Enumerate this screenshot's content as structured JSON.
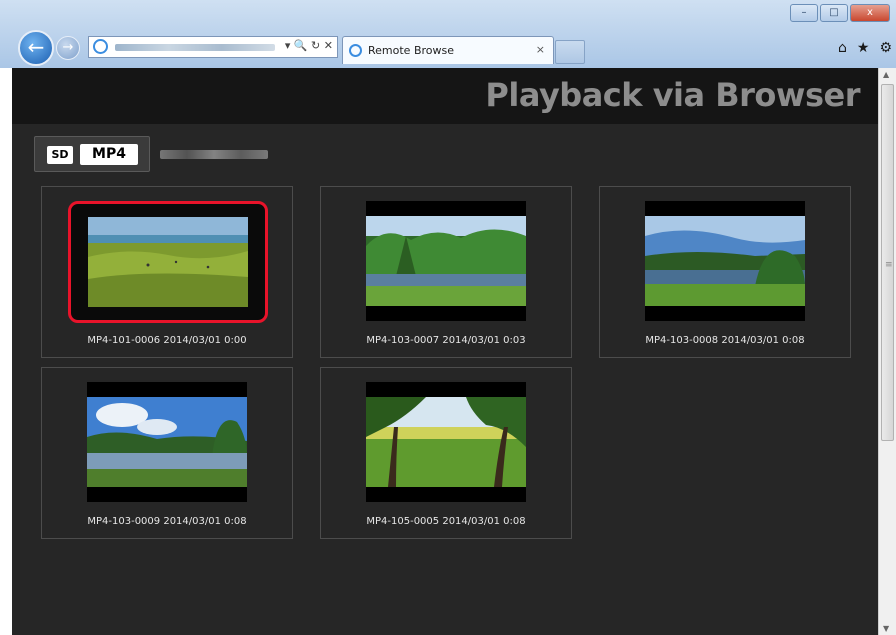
{
  "window": {
    "minimize_glyph": "–",
    "maximize_glyph": "□",
    "close_glyph": "x"
  },
  "nav": {
    "back_glyph": "←",
    "forward_glyph": "→"
  },
  "address_bar": {
    "tools_glyphs": "▾ 🔍 ↻ ✕"
  },
  "tab": {
    "title": "Remote Browse",
    "close_glyph": "×"
  },
  "toolbar_icons": {
    "home": "⌂",
    "favorites": "★",
    "settings": "⚙"
  },
  "page": {
    "title": "Playback via Browser"
  },
  "media_toggle": {
    "sd": "SD",
    "format": "MP4"
  },
  "clips": [
    {
      "caption": "MP4-101-0006 2014/03/01 0:00",
      "selected": true
    },
    {
      "caption": "MP4-103-0007 2014/03/01 0:03",
      "selected": false
    },
    {
      "caption": "MP4-103-0008 2014/03/01 0:08",
      "selected": false
    },
    {
      "caption": "MP4-103-0009 2014/03/01 0:08",
      "selected": false
    },
    {
      "caption": "MP4-105-0005 2014/03/01 0:08",
      "selected": false
    }
  ],
  "colors": {
    "page_bg": "#262626",
    "header_bg": "#151515",
    "selection": "#e8132a",
    "title_text": "#8d8d8d"
  }
}
